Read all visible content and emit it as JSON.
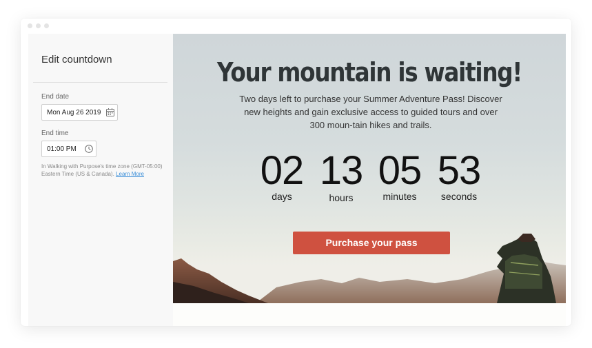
{
  "sidebar": {
    "title": "Edit countdown",
    "end_date": {
      "label": "End date",
      "value": "Mon Aug 26 2019",
      "icon": "calendar-icon"
    },
    "end_time": {
      "label": "End time",
      "value": "01:00 PM",
      "icon": "clock-icon"
    },
    "timezone_note": "In Walking with Purpose's time zone (GMT-05:00) Eastern Time (US & Canada).",
    "learn_more": "Learn More"
  },
  "preview": {
    "headline": "Your mountain is waiting!",
    "subtext": "Two days left to purchase your Summer Adventure Pass! Discover new heights and gain exclusive access to guided tours and over 300 moun-tain hikes and trails.",
    "countdown": [
      {
        "value": "02",
        "label": "days"
      },
      {
        "value": "13",
        "label": "hours"
      },
      {
        "value": "05",
        "label": "minutes"
      },
      {
        "value": "53",
        "label": "seconds"
      }
    ],
    "cta_label": "Purchase your pass"
  },
  "colors": {
    "accent": "#cf5140",
    "link": "#3a8ed8",
    "headline": "#2f3537"
  }
}
